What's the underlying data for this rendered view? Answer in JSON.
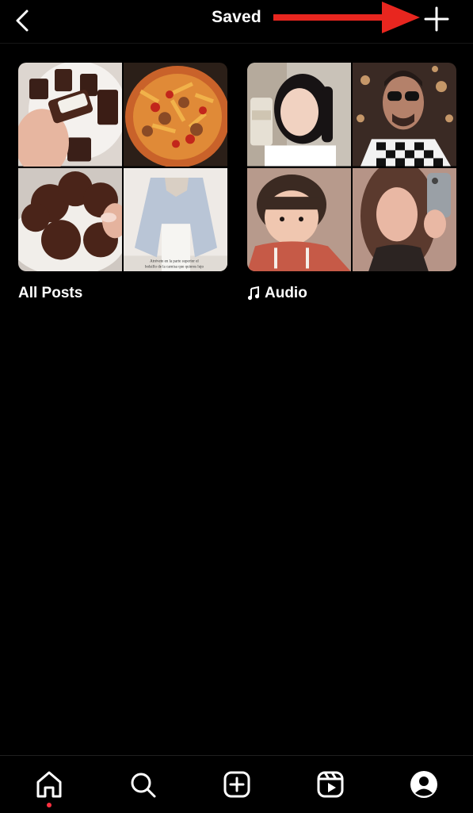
{
  "header": {
    "title": "Saved"
  },
  "collections": [
    {
      "label": "All Posts"
    },
    {
      "label": "Audio"
    }
  ],
  "tiles": {
    "post_caption": "Atrévete en la parte superior el bolsillo de la camisa que quieres lujo"
  },
  "colors": {
    "annotation_arrow": "#e8261f",
    "notification_dot": "#ff3040",
    "background": "#000000"
  },
  "tabbar": {
    "items": [
      "home-icon",
      "search-icon",
      "create-icon",
      "reels-icon",
      "profile-icon"
    ]
  }
}
